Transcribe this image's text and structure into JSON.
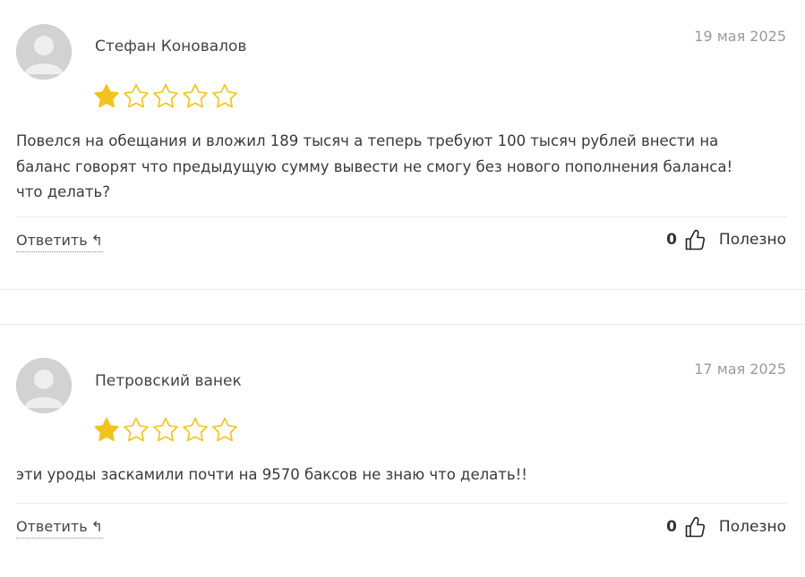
{
  "colors": {
    "star_filled": "#f2c31c",
    "star_outline": "#f2c31c",
    "date_gray": "#9a9a9a"
  },
  "reviews": [
    {
      "author": "Стефан Коновалов",
      "date": "19 мая 2025",
      "rating": 1,
      "max_rating": 5,
      "text_lines": [
        "Повелся на обещания и вложил 189 тысяч а теперь требуют 100 тысяч рублей внести на",
        "баланс говорят что предыдущую сумму вывести не смогу без нового пополнения баланса!",
        "что делать?"
      ],
      "reply_label": "Ответить",
      "reply_icon": "↰",
      "likes": "0",
      "useful_label": "Полезно"
    },
    {
      "author": "Петровский ванек",
      "date": "17 мая 2025",
      "rating": 1,
      "max_rating": 5,
      "text_lines": [
        "эти уроды заскамили почти на 9570 баксов не знаю что делать!!"
      ],
      "reply_label": "Ответить",
      "reply_icon": "↰",
      "likes": "0",
      "useful_label": "Полезно"
    }
  ]
}
